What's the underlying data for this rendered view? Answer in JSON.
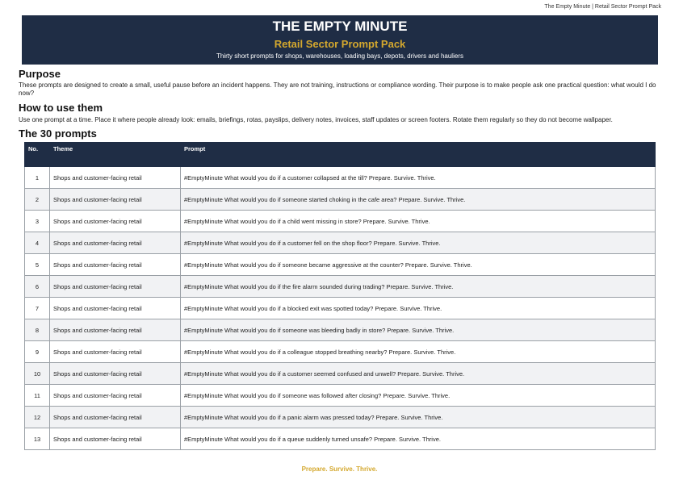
{
  "running_header": "The Empty Minute | Retail Sector Prompt Pack",
  "banner": {
    "title": "THE EMPTY MINUTE",
    "subtitle": "Retail Sector Prompt Pack",
    "tagline": "Thirty short prompts for shops, warehouses, loading bays, depots, drivers and hauliers"
  },
  "purpose": {
    "heading": "Purpose",
    "text": "These prompts are designed to create a small, useful pause before an incident happens. They are not training, instructions or compliance wording. Their purpose is to make people ask one practical question: what would I do now?"
  },
  "how_to": {
    "heading": "How to use them",
    "text": "Use one prompt at a time. Place it where people already look: emails, briefings, rotas, payslips, delivery notes, invoices, staff updates or screen footers. Rotate them regularly so they do not become wallpaper."
  },
  "prompts": {
    "heading": "The 30 prompts",
    "columns": [
      "No.",
      "Theme",
      "Prompt"
    ],
    "rows": [
      {
        "no": "1",
        "theme": "Shops and customer-facing retail",
        "prompt": "#EmptyMinute What would you do if a customer collapsed at the till? Prepare. Survive. Thrive."
      },
      {
        "no": "2",
        "theme": "Shops and customer-facing retail",
        "prompt": "#EmptyMinute What would you do if someone started choking in the cafe area? Prepare. Survive. Thrive."
      },
      {
        "no": "3",
        "theme": "Shops and customer-facing retail",
        "prompt": "#EmptyMinute What would you do if a child went missing in store? Prepare. Survive. Thrive."
      },
      {
        "no": "4",
        "theme": "Shops and customer-facing retail",
        "prompt": "#EmptyMinute What would you do if a customer fell on the shop floor? Prepare. Survive. Thrive."
      },
      {
        "no": "5",
        "theme": "Shops and customer-facing retail",
        "prompt": "#EmptyMinute What would you do if someone became aggressive at the counter? Prepare. Survive. Thrive."
      },
      {
        "no": "6",
        "theme": "Shops and customer-facing retail",
        "prompt": "#EmptyMinute What would you do if the fire alarm sounded during trading? Prepare. Survive. Thrive."
      },
      {
        "no": "7",
        "theme": "Shops and customer-facing retail",
        "prompt": "#EmptyMinute What would you do if a blocked exit was spotted today? Prepare. Survive. Thrive."
      },
      {
        "no": "8",
        "theme": "Shops and customer-facing retail",
        "prompt": "#EmptyMinute What would you do if someone was bleeding badly in store? Prepare. Survive. Thrive."
      },
      {
        "no": "9",
        "theme": "Shops and customer-facing retail",
        "prompt": "#EmptyMinute What would you do if a colleague stopped breathing nearby? Prepare. Survive. Thrive."
      },
      {
        "no": "10",
        "theme": "Shops and customer-facing retail",
        "prompt": "#EmptyMinute What would you do if a customer seemed confused and unwell? Prepare. Survive. Thrive."
      },
      {
        "no": "11",
        "theme": "Shops and customer-facing retail",
        "prompt": "#EmptyMinute What would you do if someone was followed after closing? Prepare. Survive. Thrive."
      },
      {
        "no": "12",
        "theme": "Shops and customer-facing retail",
        "prompt": "#EmptyMinute What would you do if a panic alarm was pressed today? Prepare. Survive. Thrive."
      },
      {
        "no": "13",
        "theme": "Shops and customer-facing retail",
        "prompt": "#EmptyMinute What would you do if a queue suddenly turned unsafe? Prepare. Survive. Thrive."
      }
    ]
  },
  "footer": "Prepare. Survive. Thrive.",
  "colors": {
    "navy": "#1f2d45",
    "gold": "#d4a82e",
    "row_alt": "#f1f2f4"
  }
}
